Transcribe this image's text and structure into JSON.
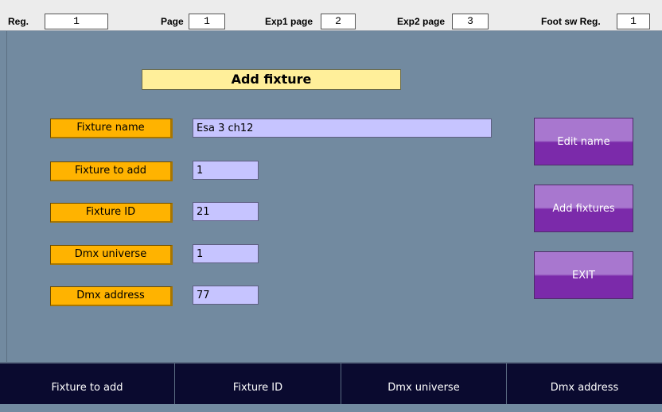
{
  "topbar": {
    "reg_label": "Reg.",
    "reg_value": "1",
    "page_label": "Page",
    "page_value": "1",
    "exp1_label": "Exp1 page",
    "exp1_value": "2",
    "exp2_label": "Exp2 page",
    "exp2_value": "3",
    "foot_label": "Foot sw Reg.",
    "foot_value": "1"
  },
  "main": {
    "title": "Add fixture",
    "fields": [
      {
        "label": "Fixture name",
        "value": "Esa 3 ch12"
      },
      {
        "label": "Fixture to add",
        "value": "1"
      },
      {
        "label": "Fixture ID",
        "value": "21"
      },
      {
        "label": "Dmx universe",
        "value": "1"
      },
      {
        "label": "Dmx address",
        "value": "77"
      }
    ],
    "buttons": {
      "edit_name": "Edit name",
      "add_fixtures": "Add fixtures",
      "exit": "EXIT"
    }
  },
  "bottom": {
    "items": [
      "Fixture to add",
      "Fixture ID",
      "Dmx universe",
      "Dmx address"
    ]
  },
  "colors": {
    "background": "#728aa0",
    "label_orange": "#ffb300",
    "input_lavender": "#c6c4ff",
    "title_yellow": "#ffef9a",
    "button_purple": "#7b2aaa",
    "bottom_navy": "#0a0a2f"
  }
}
